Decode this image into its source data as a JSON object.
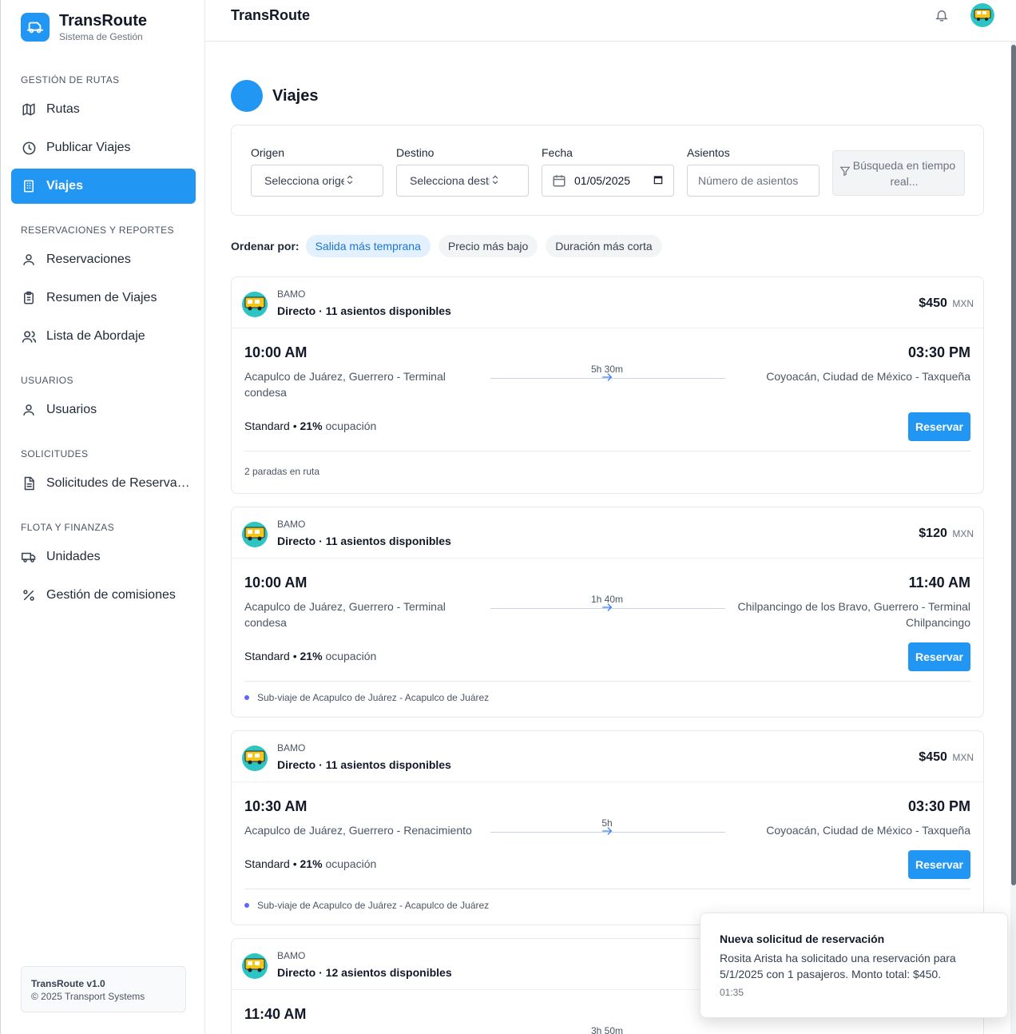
{
  "brand": {
    "name": "TransRoute",
    "subtitle": "Sistema de Gestión"
  },
  "sidebar": {
    "sections": [
      {
        "title": "GESTIÓN DE RUTAS"
      },
      {
        "title": "RESERVACIONES Y REPORTES"
      },
      {
        "title": "USUARIOS"
      },
      {
        "title": "SOLICITUDES"
      },
      {
        "title": "FLOTA Y FINANZAS"
      }
    ],
    "items": [
      {
        "label": "Rutas",
        "icon": "map-icon"
      },
      {
        "label": "Publicar Viajes",
        "icon": "clock-icon"
      },
      {
        "label": "Viajes",
        "icon": "building-icon",
        "active": true
      },
      {
        "label": "Reservaciones",
        "icon": "user-icon"
      },
      {
        "label": "Resumen de Viajes",
        "icon": "clipboard-icon"
      },
      {
        "label": "Lista de Abordaje",
        "icon": "users-icon"
      },
      {
        "label": "Usuarios",
        "icon": "user-icon"
      },
      {
        "label": "Solicitudes de Reservación",
        "icon": "document-icon"
      },
      {
        "label": "Unidades",
        "icon": "truck-icon"
      },
      {
        "label": "Gestión de comisiones",
        "icon": "percent-icon"
      }
    ],
    "version": {
      "title": "TransRoute v1.0",
      "copyright": "© 2025 Transport Systems"
    }
  },
  "topbar": {
    "title": "TransRoute"
  },
  "page": {
    "title": "Viajes"
  },
  "filters": {
    "origin": {
      "label": "Origen",
      "placeholder": "Selecciona origen"
    },
    "destination": {
      "label": "Destino",
      "placeholder": "Selecciona destino"
    },
    "date": {
      "label": "Fecha",
      "value": "01/05/2025"
    },
    "seats": {
      "label": "Asientos",
      "placeholder": "Número de asientos"
    },
    "realtime": "Búsqueda en tiempo real..."
  },
  "sort": {
    "label": "Ordenar por:",
    "options": [
      "Salida más temprana",
      "Precio más bajo",
      "Duración más corta"
    ],
    "active": "Salida más temprana"
  },
  "trips": [
    {
      "operator": "BAMO",
      "info": "Directo · 11 asientos disponibles",
      "price": "$450",
      "currency": "MXN",
      "departure_time": "10:00 AM",
      "arrival_time": "03:30 PM",
      "origin": "Acapulco de Juárez, Guerrero - Terminal condesa",
      "destination": "Coyoacán, Ciudad de México - Taxqueña",
      "duration": "5h 30m",
      "class": "Standard",
      "occupancy": "21%",
      "occupancy_word": "ocupación",
      "button": "Reservar",
      "note": "2 paradas en ruta",
      "note_dot": false
    },
    {
      "operator": "BAMO",
      "info": "Directo · 11 asientos disponibles",
      "price": "$120",
      "currency": "MXN",
      "departure_time": "10:00 AM",
      "arrival_time": "11:40 AM",
      "origin": "Acapulco de Juárez, Guerrero - Terminal condesa",
      "destination": "Chilpancingo de los Bravo, Guerrero - Terminal Chilpancingo",
      "duration": "1h 40m",
      "class": "Standard",
      "occupancy": "21%",
      "occupancy_word": "ocupación",
      "button": "Reservar",
      "note": "Sub-viaje de Acapulco de Juárez - Acapulco de Juárez",
      "note_dot": true
    },
    {
      "operator": "BAMO",
      "info": "Directo · 11 asientos disponibles",
      "price": "$450",
      "currency": "MXN",
      "departure_time": "10:30 AM",
      "arrival_time": "03:30 PM",
      "origin": "Acapulco de Juárez, Guerrero - Renacimiento",
      "destination": "Coyoacán, Ciudad de México - Taxqueña",
      "duration": "5h",
      "class": "Standard",
      "occupancy": "21%",
      "occupancy_word": "ocupación",
      "button": "Reservar",
      "note": "Sub-viaje de Acapulco de Juárez - Acapulco de Juárez",
      "note_dot": true
    },
    {
      "operator": "BAMO",
      "info": "Directo · 12 asientos disponibles",
      "departure_time": "11:40 AM",
      "duration": "3h 50m"
    }
  ],
  "toast": {
    "title": "Nueva solicitud de reservación",
    "message": "Rosita Arista ha solicitado una reservación para 5/1/2025 con 1 pasajeros. Monto total: $450.",
    "time": "01:35"
  },
  "colors": {
    "primary": "#2196f3",
    "accent_dot": "#6366f1"
  }
}
